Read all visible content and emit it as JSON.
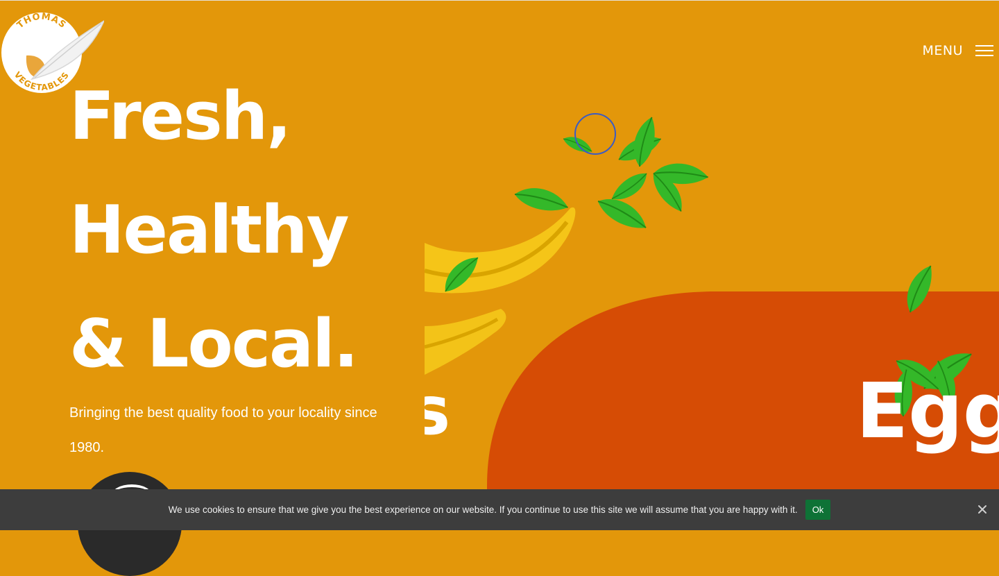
{
  "brand": {
    "top_text": "THOMAS",
    "bottom_text": "VEGETABLES"
  },
  "nav": {
    "menu_label": "MENU"
  },
  "hero": {
    "headline": [
      "Fresh,",
      "Healthy",
      "& Local."
    ],
    "tagline": "Bringing the best quality food to your locality since 1980.",
    "slide_word_left": "s",
    "slide_word_right": "Egg"
  },
  "cookie": {
    "text": "We use cookies to ensure that we give you the best experience on our website. If you continue to use this site we will assume that you are happy with it.",
    "ok_label": "Ok"
  },
  "icons": {
    "menu": "hamburger-icon",
    "close": "close-icon",
    "logo": "leaf-logo-icon"
  },
  "colors": {
    "background": "#e3970a",
    "panel": "#d64c05",
    "cookie_bar": "#3d3d3d",
    "ok_button": "#0e7236",
    "text": "#ffffff"
  }
}
